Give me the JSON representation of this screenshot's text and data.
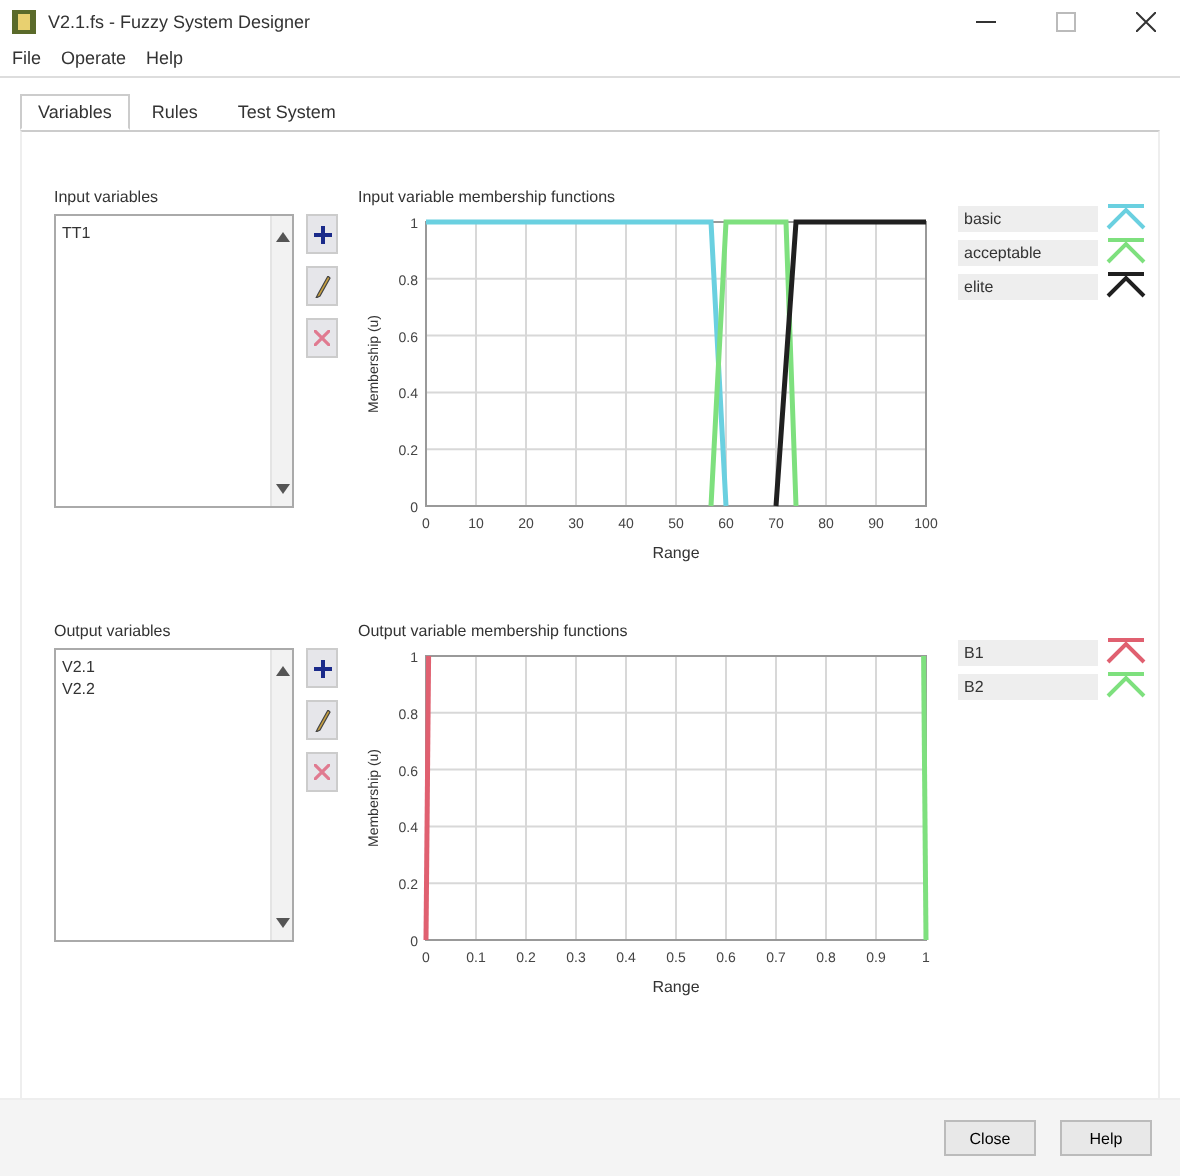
{
  "window": {
    "title": "V2.1.fs - Fuzzy System Designer"
  },
  "menu": [
    "File",
    "Operate",
    "Help"
  ],
  "tabs": [
    {
      "label": "Variables",
      "selected": true
    },
    {
      "label": "Rules",
      "selected": false
    },
    {
      "label": "Test System"
    }
  ],
  "sections": [
    {
      "list_label": "Input variables",
      "items": [
        {
          "label": "TT1",
          "selected": false
        }
      ],
      "chart_title": "Input variable membership functions",
      "chart_data": {
        "type": "line",
        "grid": true,
        "xlabel": "Range",
        "ylabel": "Membership (u)",
        "x": [
          0,
          57,
          60,
          70,
          72,
          74,
          100
        ],
        "xlim": [
          0,
          100
        ],
        "ylim": [
          0,
          1
        ],
        "series": [
          {
            "name": "basic",
            "color": "#6ad0e0",
            "values": [
              1,
              1,
              0,
              null,
              null,
              null,
              null
            ]
          },
          {
            "name": "acceptable",
            "color": "#7ee07e",
            "values": [
              null,
              0,
              1,
              1,
              1,
              0,
              null
            ]
          },
          {
            "name": "elite",
            "color": "#202020",
            "values": [
              null,
              null,
              null,
              0,
              0.5,
              1,
              1
            ]
          }
        ],
        "xticks": [
          0,
          10,
          20,
          30,
          40,
          50,
          60,
          70,
          80,
          90,
          100
        ],
        "yticks": [
          0,
          0.2,
          0.4,
          0.6,
          0.8,
          1
        ]
      }
    },
    {
      "list_label": "Output variables",
      "items": [
        {
          "label": "V2.1",
          "selected": false
        },
        {
          "label": "V2.2",
          "selected": false
        }
      ],
      "chart_title": "Output variable membership functions",
      "chart_data": {
        "type": "line",
        "grid": true,
        "xlabel": "Range",
        "ylabel": "Membership (u)",
        "x": [
          0,
          0.005,
          0.995,
          1
        ],
        "xlim": [
          0,
          1
        ],
        "ylim": [
          0,
          1
        ],
        "series": [
          {
            "name": "B1",
            "color": "#e06070",
            "values": [
              0,
              1,
              null,
              null
            ]
          },
          {
            "name": "B2",
            "color": "#7ee07e",
            "values": [
              null,
              null,
              1,
              0
            ]
          }
        ],
        "xticks": [
          0,
          0.1,
          0.2,
          0.3,
          0.4,
          0.5,
          0.6,
          0.7,
          0.8,
          0.9,
          1
        ],
        "yticks": [
          0,
          0.2,
          0.4,
          0.6,
          0.8,
          1
        ]
      }
    }
  ],
  "buttons": [
    "Close",
    "Help"
  ]
}
